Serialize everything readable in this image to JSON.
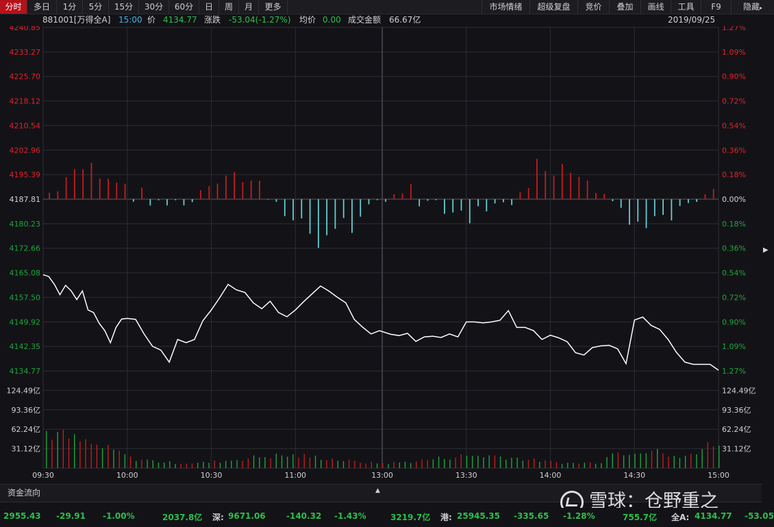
{
  "toolbar": {
    "left_tabs": [
      "分时",
      "多日",
      "1分",
      "5分",
      "15分",
      "30分",
      "60分",
      "日",
      "周",
      "月",
      "更多"
    ],
    "active_tab": "分时",
    "right_items": [
      "市场情绪",
      "超级复盘",
      "竞价",
      "叠加",
      "画线",
      "工具",
      "F9",
      "隐藏"
    ]
  },
  "info": {
    "code_name": "881001[万得全A]",
    "time": "15:00",
    "price_label": "价",
    "price": "4134.77",
    "change_label": "涨跌",
    "change": "-53.04(-1.27%)",
    "avg_label": "均价",
    "avg": "0.00",
    "turnover_label": "成交金额",
    "turnover": "66.67亿",
    "date": "2019/09/25"
  },
  "chart_data": {
    "type": "line",
    "price_axis_left": [
      "4240.85",
      "4233.27",
      "4225.70",
      "4218.12",
      "4210.54",
      "4202.96",
      "4195.39",
      "4187.81",
      "4180.23",
      "4172.66",
      "4165.08",
      "4157.50",
      "4149.92",
      "4142.35",
      "4134.77"
    ],
    "price_axis_right": [
      "1.27%",
      "1.09%",
      "0.90%",
      "0.72%",
      "0.54%",
      "0.36%",
      "0.18%",
      "0.00%",
      "0.18%",
      "0.36%",
      "0.54%",
      "0.72%",
      "0.90%",
      "1.09%",
      "1.27%"
    ],
    "ylim": [
      4134.77,
      4240.85
    ],
    "prev_close": 4187.81,
    "volume_axis": [
      "124.49亿",
      "93.36亿",
      "62.24亿",
      "31.12亿"
    ],
    "volume_ylim": [
      0,
      155.6
    ],
    "time_labels": [
      "09:30",
      "10:00",
      "10:30",
      "11:00",
      "13:00",
      "13:30",
      "14:00",
      "14:30",
      "15:00"
    ],
    "price_series_time": [
      "09:30",
      "09:32",
      "09:34",
      "09:36",
      "09:38",
      "09:40",
      "09:42",
      "09:44",
      "09:46",
      "09:48",
      "09:50",
      "09:52",
      "09:54",
      "09:56",
      "09:58",
      "10:00",
      "10:03",
      "10:06",
      "10:09",
      "10:12",
      "10:15",
      "10:18",
      "10:21",
      "10:24",
      "10:27",
      "10:30",
      "10:33",
      "10:36",
      "10:39",
      "10:42",
      "10:45",
      "10:48",
      "10:51",
      "10:54",
      "10:57",
      "11:00",
      "11:03",
      "11:06",
      "11:09",
      "11:12",
      "11:15",
      "11:18",
      "11:21",
      "11:24",
      "11:27",
      "11:30",
      "13:03",
      "13:06",
      "13:09",
      "13:12",
      "13:15",
      "13:18",
      "13:21",
      "13:24",
      "13:27",
      "13:30",
      "13:33",
      "13:36",
      "13:39",
      "13:42",
      "13:45",
      "13:48",
      "13:51",
      "13:54",
      "13:57",
      "14:00",
      "14:03",
      "14:06",
      "14:09",
      "14:12",
      "14:15",
      "14:18",
      "14:21",
      "14:24",
      "14:27",
      "14:30",
      "14:33",
      "14:36",
      "14:39",
      "14:42",
      "14:45",
      "14:48",
      "14:51",
      "14:54",
      "14:57",
      "15:00"
    ],
    "price_series": [
      4164.5,
      4163.9,
      4161.5,
      4158.3,
      4161.2,
      4159.5,
      4156.8,
      4159.5,
      4153.6,
      4152.8,
      4149.5,
      4147.2,
      4143.5,
      4148.2,
      4150.8,
      4151.0,
      4150.7,
      4146.2,
      4142.4,
      4141.2,
      4137.5,
      4144.5,
      4143.5,
      4144.5,
      4150.3,
      4153.6,
      4157.4,
      4161.5,
      4159.8,
      4159.0,
      4155.8,
      4154.0,
      4156.3,
      4152.8,
      4151.5,
      4153.6,
      4156.2,
      4158.6,
      4161.0,
      4159.4,
      4157.5,
      4155.8,
      4150.7,
      4148.3,
      4146.2,
      4147.2,
      4146.1,
      4145.7,
      4146.4,
      4143.9,
      4145.3,
      4145.5,
      4145.1,
      4146.2,
      4145.3,
      4149.9,
      4149.9,
      4149.6,
      4149.9,
      4150.4,
      4153.4,
      4148.2,
      4148.2,
      4147.2,
      4144.5,
      4145.8,
      4145.0,
      4143.8,
      4140.4,
      4139.7,
      4142.0,
      4142.5,
      4142.7,
      4141.6,
      4137.0,
      4150.5,
      4151.4,
      4148.8,
      4147.6,
      4144.5,
      4140.5,
      4137.5,
      4136.8,
      4136.8,
      4136.8,
      4135.0
    ]
  },
  "flow": {
    "label": "资金流向"
  },
  "bottom": {
    "sh_price": "2955.43",
    "sh_change": "-29.91",
    "sh_pct": "-1.00%",
    "sh_amount": "2037.8亿",
    "sz_label": "深:",
    "sz_price": "9671.06",
    "sz_change": "-140.32",
    "sz_pct": "-1.43%",
    "sz_amount": "3219.7亿",
    "hk_label": "港:",
    "hk_price": "25945.35",
    "hk_change": "-335.65",
    "hk_pct": "-1.28%",
    "hk_amount": "755.7亿",
    "all_label": "全A:",
    "all_price": "4134.77",
    "all_change": "-53.05"
  },
  "watermark": {
    "text": "雪球：仓野重之"
  },
  "colors": {
    "up": "#e0232a",
    "down": "#1fa53b",
    "bar_up": "#c41c1c",
    "bar_down": "#5fcfd3",
    "line": "#ffffff",
    "grid": "#2c2c34"
  }
}
